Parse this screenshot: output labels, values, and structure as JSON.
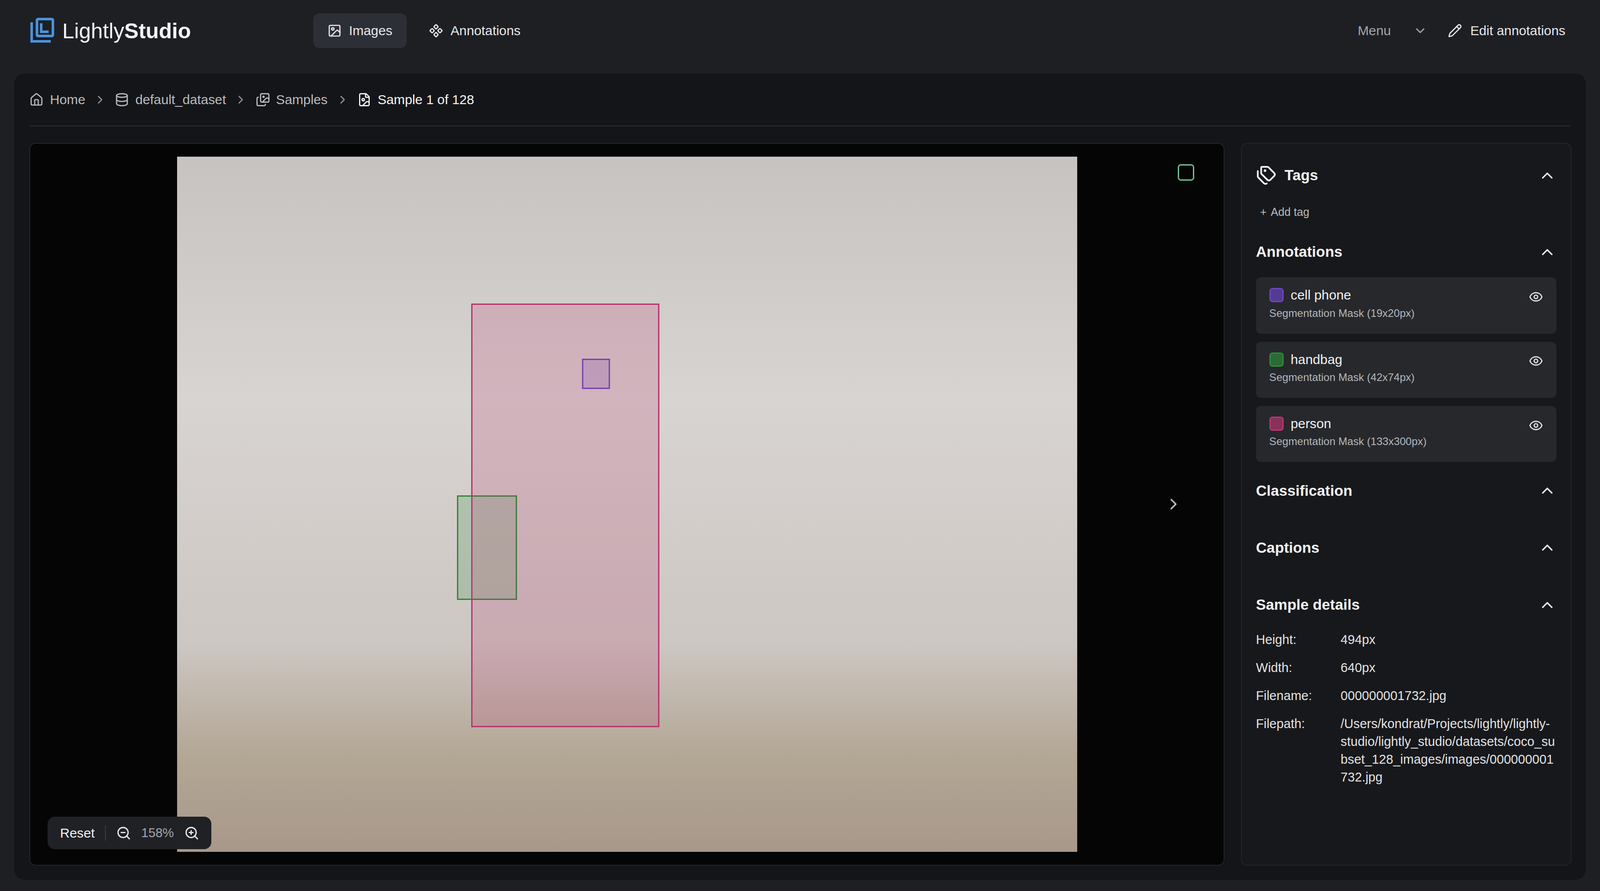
{
  "app": {
    "logo": {
      "light": "Lightly",
      "bold": "Studio"
    }
  },
  "nav": [
    {
      "label": "Images",
      "selected": true
    },
    {
      "label": "Annotations",
      "selected": false
    }
  ],
  "header_actions": {
    "menu": "Menu",
    "edit": "Edit annotations"
  },
  "breadcrumb": [
    "Home",
    "default_dataset",
    "Samples",
    "Sample 1 of 128"
  ],
  "viewer": {
    "selected": false,
    "zoom": {
      "reset": "Reset",
      "level": "158%"
    }
  },
  "sidebar": {
    "tags": {
      "title": "Tags",
      "expanded": true,
      "add_icon": "+",
      "add_label": "Add tag"
    },
    "annotations": {
      "title": "Annotations",
      "expanded": true,
      "items": [
        {
          "label": "cell phone",
          "subtitle": "Segmentation Mask (19x20px)",
          "color": "#6a45c2",
          "visible": true
        },
        {
          "label": "handbag",
          "subtitle": "Segmentation Mask (42x74px)",
          "color": "#2f8a3a",
          "visible": true
        },
        {
          "label": "person",
          "subtitle": "Segmentation Mask (133x300px)",
          "color": "#b8376f",
          "visible": true
        }
      ]
    },
    "classification": {
      "title": "Classification",
      "expanded": true
    },
    "captions": {
      "title": "Captions",
      "expanded": true
    },
    "sample_details": {
      "title": "Sample details",
      "expanded": true,
      "fields": [
        {
          "label": "Height:",
          "value": "494px"
        },
        {
          "label": "Width:",
          "value": "640px"
        },
        {
          "label": "Filename:",
          "value": "000000001732.jpg"
        },
        {
          "label": "Filepath:",
          "value": "/Users/kondrat/Projects/lightly/lightly-studio/lightly_studio/datasets/coco_subset_128_images/images/000000001732.jpg"
        }
      ]
    }
  }
}
